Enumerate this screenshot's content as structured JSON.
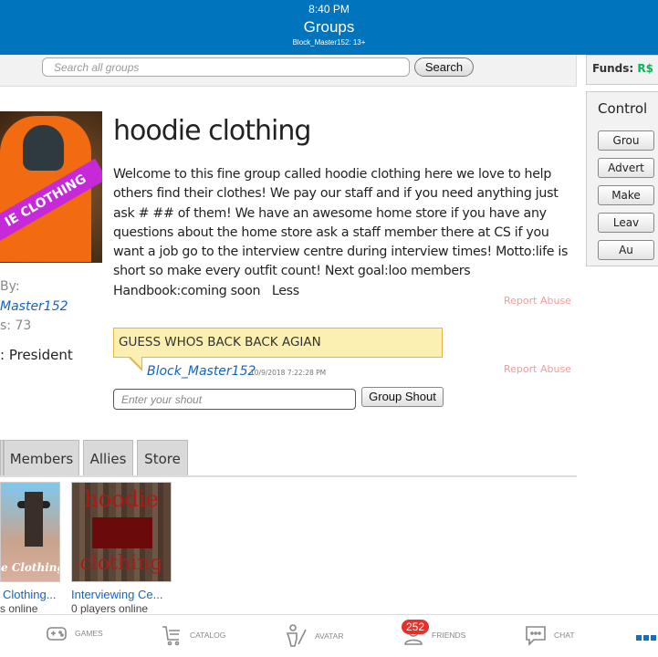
{
  "status_bar": {
    "time": "8:40 PM"
  },
  "header": {
    "title": "Groups",
    "subtitle": "Block_Master152: 13+"
  },
  "search": {
    "placeholder": "Search all groups",
    "button": "Search"
  },
  "funds": {
    "label": "Funds:",
    "currency": "R$"
  },
  "controls": {
    "title": "Control",
    "buttons": [
      "Grou",
      "Advert",
      "Make",
      "Leav",
      "Au"
    ]
  },
  "owner": {
    "by_label": "By:",
    "owner_name": "Master152",
    "members": "s: 73",
    "rank": ": President"
  },
  "group": {
    "name": "hoodie clothing",
    "emblem_text": "HOODIE CLOTHING",
    "description": "Welcome to this fine group called hoodie clothing here we love to help others find their clothes! We pay our staff and if you need anything just ask # ## of them! We have an awesome home store if you have any questions about the home store ask a staff member there at CS if you want a job go to the interview centre during interview times! Motto:life is short so make every outfit count! Next goal:loo members Handbook:coming soon",
    "less": "Less",
    "report_abuse": "Report Abuse"
  },
  "shout": {
    "text": "GUESS WHOS BACK BACK AGIAN",
    "poster": "Block_Master152",
    "date": "10/9/2018 7:22:28 PM",
    "report_abuse": "Report Abuse",
    "placeholder": "Enter your shout",
    "button": "Group Shout"
  },
  "tabs": [
    "Members",
    "Allies",
    "Store"
  ],
  "games": [
    {
      "name": "Clothing...",
      "players": "s online",
      "thumb_text": "e Clothing"
    },
    {
      "name": "Interviewing Ce...",
      "players": "0 players online",
      "thumb_text_top": "hoodie",
      "thumb_text_bottom": "clothing"
    }
  ],
  "bottom_nav": {
    "items": [
      {
        "label": "GAMES",
        "icon": "gamepad-icon"
      },
      {
        "label": "CATALOG",
        "icon": "cart-icon"
      },
      {
        "label": "AVATAR",
        "icon": "avatar-icon"
      },
      {
        "label": "FRIENDS",
        "icon": "friends-icon"
      },
      {
        "label": "CHAT",
        "icon": "chat-icon"
      }
    ],
    "friends_badge": "252"
  },
  "colors": {
    "header": "#0074bd",
    "link": "#1565c0",
    "report": "#f59b9b",
    "badge": "#e8302b",
    "shout_bg": "#fbf0b2"
  }
}
